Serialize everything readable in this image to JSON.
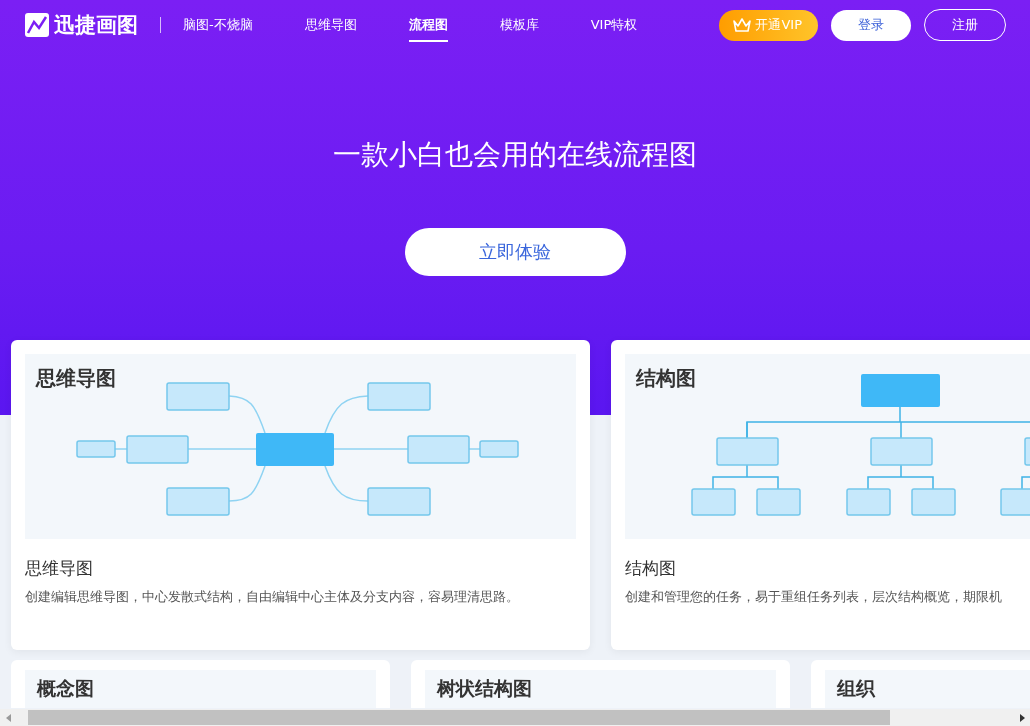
{
  "header": {
    "logo": "迅捷画图",
    "slogan": "脑图-不烧脑",
    "nav": [
      {
        "label": "思维导图",
        "selected": false
      },
      {
        "label": "流程图",
        "selected": true
      },
      {
        "label": "模板库",
        "selected": false
      },
      {
        "label": "VIP特权",
        "selected": false
      }
    ],
    "vip_button": "开通VIP",
    "login_button": "登录",
    "register_button": "注册"
  },
  "hero": {
    "headline": "一款小白也会用的在线流程图",
    "cta": "立即体验"
  },
  "cards": [
    {
      "kind": "mind_map",
      "preview_title": "思维导图",
      "title": "思维导图",
      "description": "创建编辑思维导图，中心发散式结构，自由编辑中心主体及分支内容，容易理清思路。"
    },
    {
      "kind": "org_chart",
      "preview_title": "结构图",
      "title": "结构图",
      "description": "创建和管理您的任务，易于重组任务列表，层次结构概览，期限机"
    }
  ],
  "more_cards": [
    {
      "preview_title": "概念图"
    },
    {
      "preview_title": "树状结构图"
    },
    {
      "preview_title": "组织"
    }
  ]
}
